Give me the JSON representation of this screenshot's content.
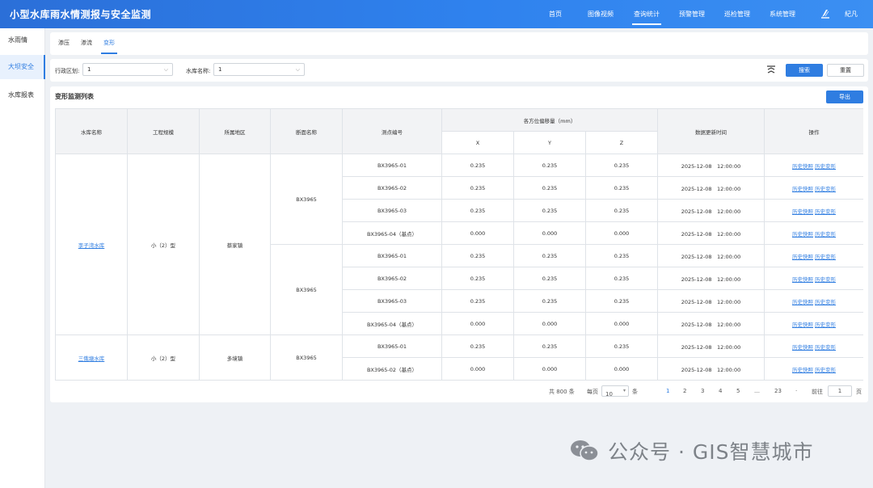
{
  "app": {
    "title": "小型水库雨水情测报与安全监测"
  },
  "nav": [
    "首页",
    "图像视频",
    "查询统计",
    "预警管理",
    "巡检管理",
    "系统管理"
  ],
  "nav_active": "查询统计",
  "user": {
    "name": "紀凡"
  },
  "sidebar": {
    "items": [
      "水雨情",
      "大坝安全",
      "水库报表"
    ],
    "active": "大坝安全"
  },
  "tabs": {
    "items": [
      "渗压",
      "渗流",
      "变形"
    ],
    "active": "变形"
  },
  "filters": {
    "region_label": "行政区划:",
    "region_value": "1",
    "reservoir_label": "水库名称:",
    "reservoir_value": "1",
    "search_label": "搜索",
    "reset_label": "重置"
  },
  "list": {
    "title": "变形监测列表",
    "export_label": "导出",
    "headers": {
      "reservoir": "水库名称",
      "scale": "工程规模",
      "region": "所属地区",
      "section": "断面名称",
      "point": "测点编号",
      "displacement_group": "各方位偏移量（mm）",
      "x": "X",
      "y": "Y",
      "z": "Z",
      "updated": "数据更新时间",
      "ops": "操作"
    },
    "op_labels": [
      "历史快照",
      "历史变形"
    ],
    "groups": [
      {
        "reservoir": "李子湾水库",
        "scale": "小（2）型",
        "region": "蔡家镇",
        "sections": [
          {
            "name": "BX3965",
            "rows": [
              {
                "point": "BX3965-01",
                "x": "0.235",
                "y": "0.235",
                "z": "0.235",
                "time": "2025-12-08　12:00:00"
              },
              {
                "point": "BX3965-02",
                "x": "0.235",
                "y": "0.235",
                "z": "0.235",
                "time": "2025-12-08　12:00:00"
              },
              {
                "point": "BX3965-03",
                "x": "0.235",
                "y": "0.235",
                "z": "0.235",
                "time": "2025-12-08　12:00:00"
              },
              {
                "point": "BX3965-04（基点）",
                "x": "0.000",
                "y": "0.000",
                "z": "0.000",
                "time": "2025-12-08　12:00:00"
              }
            ]
          },
          {
            "name": "BX3965",
            "rows": [
              {
                "point": "BX3965-01",
                "x": "0.235",
                "y": "0.235",
                "z": "0.235",
                "time": "2025-12-08　12:00:00"
              },
              {
                "point": "BX3965-02",
                "x": "0.235",
                "y": "0.235",
                "z": "0.235",
                "time": "2025-12-08　12:00:00"
              },
              {
                "point": "BX3965-03",
                "x": "0.235",
                "y": "0.235",
                "z": "0.235",
                "time": "2025-12-08　12:00:00"
              },
              {
                "point": "BX3965-04（基点）",
                "x": "0.000",
                "y": "0.000",
                "z": "0.000",
                "time": "2025-12-08　12:00:00"
              }
            ]
          }
        ]
      },
      {
        "reservoir": "三俄塘水库",
        "scale": "小（2）型",
        "region": "多境镇",
        "sections": [
          {
            "name": "BX3965",
            "rows": [
              {
                "point": "BX3965-01",
                "x": "0.235",
                "y": "0.235",
                "z": "0.235",
                "time": "2025-12-08　12:00:00"
              },
              {
                "point": "BX3965-02（基点）",
                "x": "0.000",
                "y": "0.000",
                "z": "0.000",
                "time": "2025-12-08　12:00:00"
              }
            ]
          }
        ]
      }
    ]
  },
  "pagination": {
    "total": "共 800 条",
    "per_page_label": "每页",
    "per_page_value": "10",
    "per_page_unit": "条",
    "pages": [
      "1",
      "2",
      "3",
      "4",
      "5",
      "…",
      "23",
      "·"
    ],
    "current": "1",
    "goto_label": "前往",
    "goto_value": "1",
    "goto_unit": "页"
  },
  "watermark": {
    "text": "公众号 · GIS智慧城市"
  },
  "colors": {
    "header": "#2f7de1",
    "accent": "#2f7de1",
    "link": "#2f7de1"
  }
}
